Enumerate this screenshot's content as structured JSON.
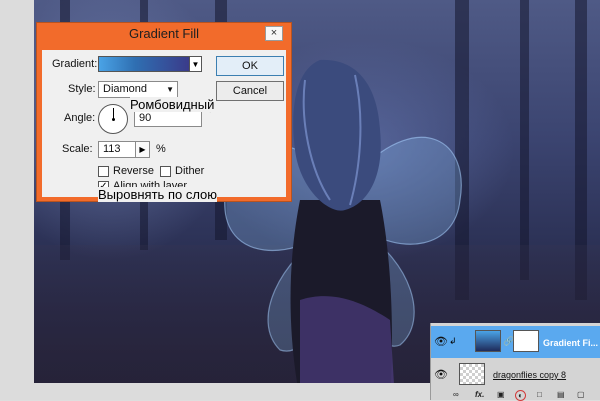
{
  "dialog": {
    "title": "Gradient Fill",
    "close_glyph": "×",
    "gradient_label": "Gradient:",
    "style_label": "Style:",
    "style_value": "Diamond",
    "angle_label": "Angle:",
    "angle_value": "90",
    "degree_symbol": "°",
    "scale_label": "Scale:",
    "scale_value": "113",
    "percent_symbol": "%",
    "reverse_label": "Reverse",
    "dither_label": "Dither",
    "align_label": "Align with layer",
    "ok_label": "OK",
    "cancel_label": "Cancel",
    "reverse_checked": false,
    "dither_checked": false,
    "align_checked": true,
    "gradient_colors": [
      "#4aa3e6",
      "#2f6fb2",
      "#3a3b8a"
    ]
  },
  "captions": {
    "style_translation": "Ромбовидный",
    "align_translation": "Выровнять по слою"
  },
  "layers": {
    "items": [
      {
        "name": "Gradient Fi...",
        "selected": true,
        "visible": true
      },
      {
        "name": "dragonflies copy 8",
        "selected": false,
        "visible": true
      }
    ],
    "footer_fx_label": "fx."
  },
  "colors": {
    "dialog_frame": "#f26b2b",
    "layer_selected": "#5aa9ef",
    "canvas_dark": "#2a2f52"
  },
  "icons": [
    "close-icon",
    "eye-icon",
    "link-icon",
    "fx-icon",
    "adjustment-icon",
    "folder-icon",
    "new-layer-icon",
    "trash-icon",
    "mask-icon"
  ]
}
